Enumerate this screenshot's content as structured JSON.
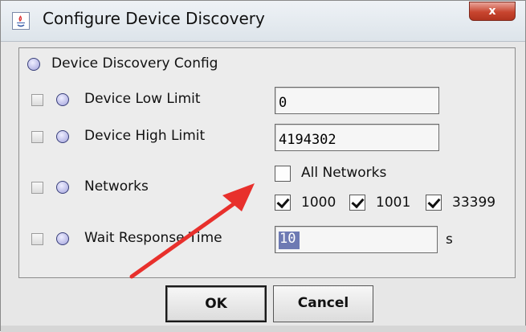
{
  "window": {
    "title": "Configure Device Discovery",
    "close_label": "x"
  },
  "panel": {
    "header": "Device Discovery Config",
    "rows": [
      {
        "label": "Device Low Limit",
        "value": "0"
      },
      {
        "label": "Device High Limit",
        "value": "4194302"
      }
    ],
    "networks": {
      "label": "Networks",
      "all_label": "All Networks",
      "all_checked": false,
      "items": [
        {
          "label": "1000",
          "checked": true
        },
        {
          "label": "1001",
          "checked": true
        },
        {
          "label": "33399",
          "checked": true
        }
      ]
    },
    "wait": {
      "label": "Wait Response Time",
      "value": "10",
      "unit": "s"
    }
  },
  "buttons": {
    "ok": "OK",
    "cancel": "Cancel"
  },
  "colors": {
    "annotation_arrow": "#e8302c",
    "selection": "#6e7ab3"
  }
}
